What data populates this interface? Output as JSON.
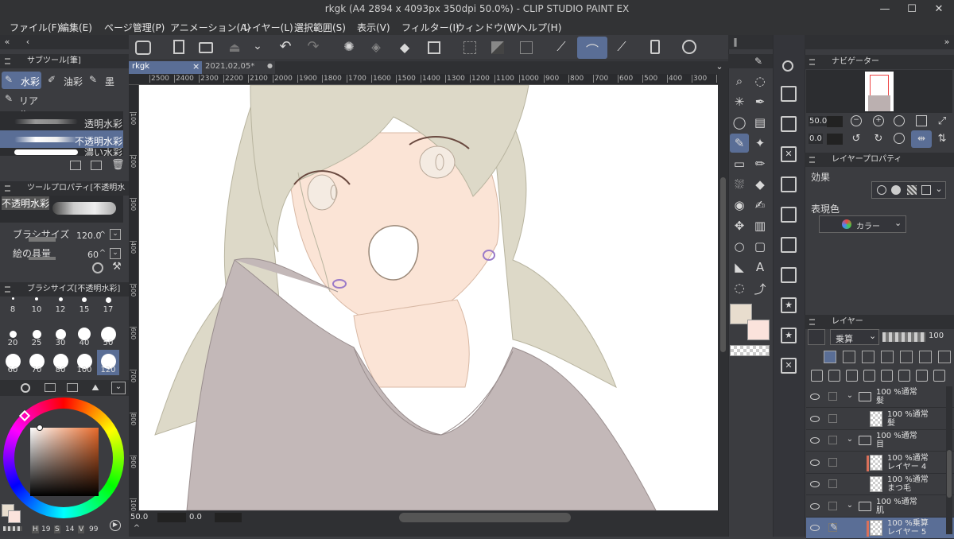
{
  "window": {
    "title": "rkgk (A4 2894 x 4093px 350dpi 50.0%) - CLIP STUDIO PAINT EX"
  },
  "menu": [
    "ファイル(F)",
    "編集(E)",
    "ページ管理(P)",
    "アニメーション(A)",
    "レイヤー(L)",
    "選択範囲(S)",
    "表示(V)",
    "フィルター(I)",
    "ウィンドウ(W)",
    "ヘルプ(H)"
  ],
  "tabs": [
    {
      "label": "rkgk",
      "close": "×"
    },
    {
      "label": "2021,02,05*",
      "close": "●"
    }
  ],
  "subtool": {
    "header": "サブツール[筆]",
    "groups": [
      "水彩",
      "油彩",
      "墨",
      "リアル"
    ],
    "brushes": [
      "透明水彩",
      "不透明水彩",
      "濃い水彩"
    ]
  },
  "toolprop": {
    "header": "ツールプロパティ[不透明水彩]",
    "preview_label": "不透明水彩",
    "brush_size_label": "ブラシサイズ",
    "brush_size_value": "120.0",
    "paint_amount_label": "絵の具量",
    "paint_amount_value": "60"
  },
  "brushsize": {
    "header": "ブラシサイズ[不透明水彩]",
    "sizes": [
      "8",
      "10",
      "12",
      "15",
      "17",
      "20",
      "25",
      "30",
      "40",
      "50",
      "60",
      "70",
      "80",
      "100",
      "120"
    ],
    "selected": "120"
  },
  "color": {
    "h": "H",
    "h_val": "19",
    "s": "S",
    "s_val": "14",
    "v": "V",
    "v_val": "99",
    "main": "#e8ddce",
    "sub": "#fbe3dc"
  },
  "ruler_top": [
    "2500",
    "2400",
    "2300",
    "2200",
    "2100",
    "2000",
    "1900",
    "1800",
    "1700",
    "1600",
    "1500",
    "1400",
    "1300",
    "1200",
    "1100",
    "1000",
    "900",
    "800",
    "700",
    "600",
    "500",
    "400",
    "300",
    "200",
    "100"
  ],
  "ruler_left": [
    "100",
    "200",
    "300",
    "400",
    "500",
    "600",
    "700",
    "800",
    "900",
    "1000"
  ],
  "statusbar": {
    "zoom": "50.0",
    "rotate": "0.0"
  },
  "navigator": {
    "header": "ナビゲーター",
    "zoom": "50.0",
    "rotate": "0.0"
  },
  "layerprop": {
    "header": "レイヤープロパティ",
    "effect_label": "効果",
    "expression_label": "表現色",
    "color_option": "カラー"
  },
  "layers_panel": {
    "header": "レイヤー",
    "blend": "乗算",
    "opacity": "100",
    "rows": [
      {
        "line1": "100 %通常",
        "line2": "髪",
        "kind": "folder"
      },
      {
        "line1": "100 %通常",
        "line2": "髪",
        "kind": "layer"
      },
      {
        "line1": "100 %通常",
        "line2": "目",
        "kind": "folder"
      },
      {
        "line1": "100 %通常",
        "line2": "レイヤー 4",
        "kind": "layer"
      },
      {
        "line1": "100 %通常",
        "line2": "まつ毛",
        "kind": "layer"
      },
      {
        "line1": "100 %通常",
        "line2": "肌",
        "kind": "folder"
      },
      {
        "line1": "100 %乗算",
        "line2": "レイヤー 5",
        "kind": "layer"
      }
    ]
  },
  "colors": {
    "accent": "#5a6e96",
    "panel": "#3b3c40",
    "dark": "#2f3033",
    "canvas_bg": "#ffffff"
  }
}
